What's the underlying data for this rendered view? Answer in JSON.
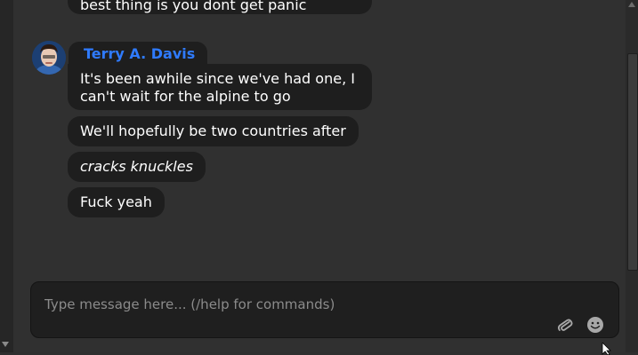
{
  "messages": {
    "previous_partial": "best thing is you dont get panic",
    "author": "Terry A. Davis",
    "items": [
      "It's been awhile since we've had one, I can't wait for the alpine to go",
      "We'll hopefully be two countries after",
      "cracks knuckles",
      "Fuck yeah"
    ]
  },
  "composer": {
    "placeholder": "Type message here... (/help for commands)",
    "attach_icon": "paperclip-icon",
    "emoji_icon": "smiley-icon"
  },
  "colors": {
    "background": "#303030",
    "bubble": "#1e1e1e",
    "author_name": "#2f7bff",
    "placeholder": "#8b8b8b"
  }
}
